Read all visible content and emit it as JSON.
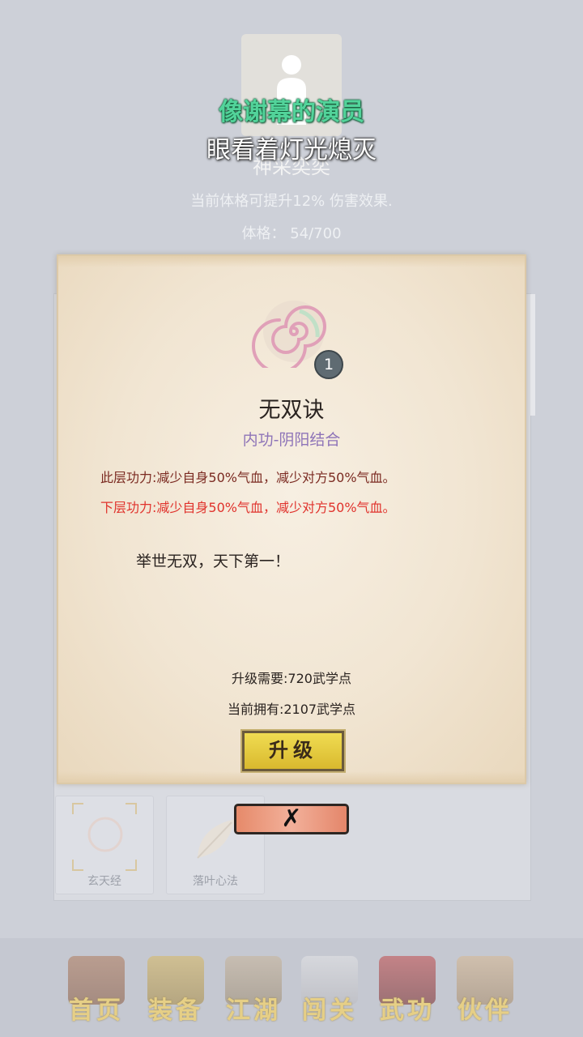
{
  "background": {
    "overlay_line1": "像谢幕的演员",
    "overlay_line2": "眼看着灯光熄灭",
    "level_name": "神采奕奕",
    "description": "当前体格可提升12% 伤害效果.",
    "stat": "体格： 54/700",
    "skill_list": [
      {
        "label": "玄天经",
        "icon": "xuan-seal-icon"
      },
      {
        "label": "落叶心法",
        "icon": "leaf-icon"
      }
    ]
  },
  "modal": {
    "emblem_icon": "spiral-emblem-icon",
    "level": "1",
    "title": "无双诀",
    "type": "内功-阴阳结合",
    "current_effect": "此层功力:减少自身50%气血，减少对方50%气血。",
    "next_effect": "下层功力:减少自身50%气血，减少对方50%气血。",
    "flavor": "举世无双，天下第一！",
    "requirement": "升级需要:720武学点",
    "owned": "当前拥有:2107武学点",
    "upgrade_label": "升级",
    "close_icon": "close-x-icon",
    "close_label": "✗"
  },
  "nav": [
    {
      "label": "首页",
      "icon": "home-house-icon"
    },
    {
      "label": "装备",
      "icon": "armor-icon"
    },
    {
      "label": "江湖",
      "icon": "scroll-map-icon"
    },
    {
      "label": "闯关",
      "icon": "crossed-swords-icon"
    },
    {
      "label": "武功",
      "icon": "martial-book-icon"
    },
    {
      "label": "伙伴",
      "icon": "partners-icon"
    }
  ],
  "colors": {
    "accent_green": "#52d39a",
    "effect_current": "#7b2a21",
    "effect_next": "#e0322c",
    "type_purple": "#8e74b8",
    "upgrade_yellow": "#e8cd3f",
    "close_red": "#ec9a80"
  }
}
